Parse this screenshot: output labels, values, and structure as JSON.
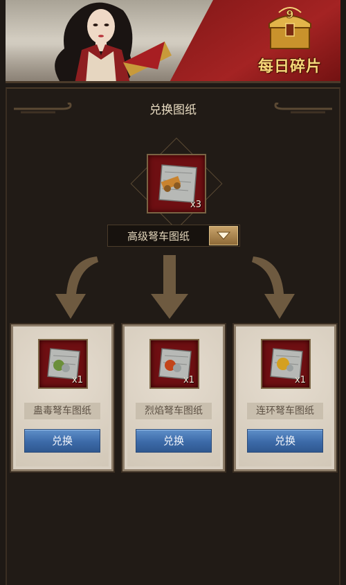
{
  "banner": {
    "daily_label": "每日碎片",
    "chest_badge": "9"
  },
  "panel": {
    "title": "兑换图纸"
  },
  "source_item": {
    "quantity": "x3"
  },
  "dropdown": {
    "selected": "高级弩车图纸",
    "icon": "triangle-down-icon"
  },
  "cards": [
    {
      "name": "蛊毒弩车图纸",
      "quantity": "x1",
      "button": "兑换",
      "accent": "#6b8f3a"
    },
    {
      "name": "烈焰弩车图纸",
      "quantity": "x1",
      "button": "兑换",
      "accent": "#c2451a"
    },
    {
      "name": "连环弩车图纸",
      "quantity": "x1",
      "button": "兑换",
      "accent": "#d4a020"
    }
  ],
  "colors": {
    "button_blue": "#3c6aa8",
    "slot_red": "#6e0f12",
    "banner_red": "#a42323"
  }
}
